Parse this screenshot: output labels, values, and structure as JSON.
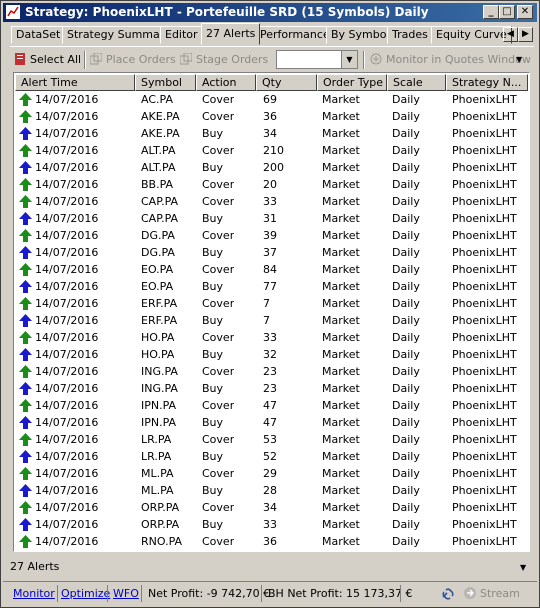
{
  "window": {
    "title": "Strategy: PhoenixLHT - Portefeuille SRD (15 Symbols) Daily",
    "min_label": "_",
    "max_label": "□",
    "close_label": "✕"
  },
  "tabs": [
    "DataSet",
    "Strategy Summary",
    "Editor",
    "27 Alerts",
    "Performance",
    "By Symbol",
    "Trades",
    "Equity Curve"
  ],
  "active_tab": "27 Alerts",
  "toolbar": {
    "select_all": "Select All",
    "place_orders": "Place Orders",
    "stage_orders": "Stage Orders",
    "monitor_quotes": "Monitor in Quotes Window",
    "combo_value": ""
  },
  "columns": [
    "Alert Time",
    "Symbol",
    "Action",
    "Qty",
    "Order Type",
    "Scale",
    "Strategy N..."
  ],
  "rows": [
    {
      "time": "14/07/2016",
      "symbol": "AC.PA",
      "action": "Cover",
      "qty": "69",
      "type": "Market",
      "scale": "Daily",
      "strategy": "PhoenixLHT"
    },
    {
      "time": "14/07/2016",
      "symbol": "AKE.PA",
      "action": "Cover",
      "qty": "36",
      "type": "Market",
      "scale": "Daily",
      "strategy": "PhoenixLHT"
    },
    {
      "time": "14/07/2016",
      "symbol": "AKE.PA",
      "action": "Buy",
      "qty": "34",
      "type": "Market",
      "scale": "Daily",
      "strategy": "PhoenixLHT"
    },
    {
      "time": "14/07/2016",
      "symbol": "ALT.PA",
      "action": "Cover",
      "qty": "210",
      "type": "Market",
      "scale": "Daily",
      "strategy": "PhoenixLHT"
    },
    {
      "time": "14/07/2016",
      "symbol": "ALT.PA",
      "action": "Buy",
      "qty": "200",
      "type": "Market",
      "scale": "Daily",
      "strategy": "PhoenixLHT"
    },
    {
      "time": "14/07/2016",
      "symbol": "BB.PA",
      "action": "Cover",
      "qty": "20",
      "type": "Market",
      "scale": "Daily",
      "strategy": "PhoenixLHT"
    },
    {
      "time": "14/07/2016",
      "symbol": "CAP.PA",
      "action": "Cover",
      "qty": "33",
      "type": "Market",
      "scale": "Daily",
      "strategy": "PhoenixLHT"
    },
    {
      "time": "14/07/2016",
      "symbol": "CAP.PA",
      "action": "Buy",
      "qty": "31",
      "type": "Market",
      "scale": "Daily",
      "strategy": "PhoenixLHT"
    },
    {
      "time": "14/07/2016",
      "symbol": "DG.PA",
      "action": "Cover",
      "qty": "39",
      "type": "Market",
      "scale": "Daily",
      "strategy": "PhoenixLHT"
    },
    {
      "time": "14/07/2016",
      "symbol": "DG.PA",
      "action": "Buy",
      "qty": "37",
      "type": "Market",
      "scale": "Daily",
      "strategy": "PhoenixLHT"
    },
    {
      "time": "14/07/2016",
      "symbol": "EO.PA",
      "action": "Cover",
      "qty": "84",
      "type": "Market",
      "scale": "Daily",
      "strategy": "PhoenixLHT"
    },
    {
      "time": "14/07/2016",
      "symbol": "EO.PA",
      "action": "Buy",
      "qty": "77",
      "type": "Market",
      "scale": "Daily",
      "strategy": "PhoenixLHT"
    },
    {
      "time": "14/07/2016",
      "symbol": "ERF.PA",
      "action": "Cover",
      "qty": "7",
      "type": "Market",
      "scale": "Daily",
      "strategy": "PhoenixLHT"
    },
    {
      "time": "14/07/2016",
      "symbol": "ERF.PA",
      "action": "Buy",
      "qty": "7",
      "type": "Market",
      "scale": "Daily",
      "strategy": "PhoenixLHT"
    },
    {
      "time": "14/07/2016",
      "symbol": "HO.PA",
      "action": "Cover",
      "qty": "33",
      "type": "Market",
      "scale": "Daily",
      "strategy": "PhoenixLHT"
    },
    {
      "time": "14/07/2016",
      "symbol": "HO.PA",
      "action": "Buy",
      "qty": "32",
      "type": "Market",
      "scale": "Daily",
      "strategy": "PhoenixLHT"
    },
    {
      "time": "14/07/2016",
      "symbol": "ING.PA",
      "action": "Cover",
      "qty": "23",
      "type": "Market",
      "scale": "Daily",
      "strategy": "PhoenixLHT"
    },
    {
      "time": "14/07/2016",
      "symbol": "ING.PA",
      "action": "Buy",
      "qty": "23",
      "type": "Market",
      "scale": "Daily",
      "strategy": "PhoenixLHT"
    },
    {
      "time": "14/07/2016",
      "symbol": "IPN.PA",
      "action": "Cover",
      "qty": "47",
      "type": "Market",
      "scale": "Daily",
      "strategy": "PhoenixLHT"
    },
    {
      "time": "14/07/2016",
      "symbol": "IPN.PA",
      "action": "Buy",
      "qty": "47",
      "type": "Market",
      "scale": "Daily",
      "strategy": "PhoenixLHT"
    },
    {
      "time": "14/07/2016",
      "symbol": "LR.PA",
      "action": "Cover",
      "qty": "53",
      "type": "Market",
      "scale": "Daily",
      "strategy": "PhoenixLHT"
    },
    {
      "time": "14/07/2016",
      "symbol": "LR.PA",
      "action": "Buy",
      "qty": "52",
      "type": "Market",
      "scale": "Daily",
      "strategy": "PhoenixLHT"
    },
    {
      "time": "14/07/2016",
      "symbol": "ML.PA",
      "action": "Cover",
      "qty": "29",
      "type": "Market",
      "scale": "Daily",
      "strategy": "PhoenixLHT"
    },
    {
      "time": "14/07/2016",
      "symbol": "ML.PA",
      "action": "Buy",
      "qty": "28",
      "type": "Market",
      "scale": "Daily",
      "strategy": "PhoenixLHT"
    },
    {
      "time": "14/07/2016",
      "symbol": "ORP.PA",
      "action": "Cover",
      "qty": "34",
      "type": "Market",
      "scale": "Daily",
      "strategy": "PhoenixLHT"
    },
    {
      "time": "14/07/2016",
      "symbol": "ORP.PA",
      "action": "Buy",
      "qty": "33",
      "type": "Market",
      "scale": "Daily",
      "strategy": "PhoenixLHT"
    },
    {
      "time": "14/07/2016",
      "symbol": "RNO.PA",
      "action": "Cover",
      "qty": "36",
      "type": "Market",
      "scale": "Daily",
      "strategy": "PhoenixLHT"
    }
  ],
  "colors": {
    "cover_arrow": "#1a8c1a",
    "buy_arrow": "#1a1acc",
    "titlebar": "#0a246a"
  },
  "status": {
    "alert_count": "27 Alerts"
  },
  "bottom": {
    "monitor": "Monitor",
    "optimize": "Optimize",
    "wfo": "WFO",
    "net_profit": "Net Profit: -9 742,70 €",
    "bh_net_profit": "BH Net Profit: 15 173,37 €",
    "stream": "Stream"
  }
}
